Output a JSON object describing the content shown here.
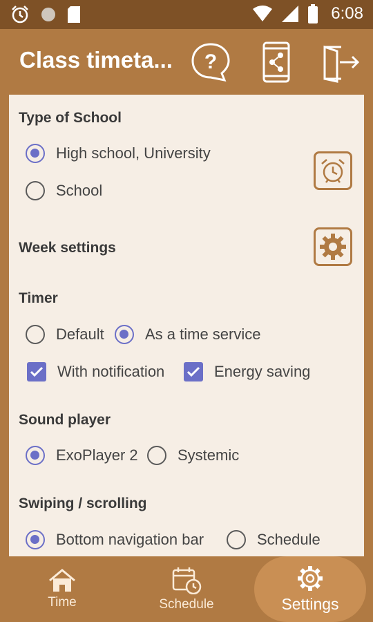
{
  "status": {
    "time": "6:08"
  },
  "appbar": {
    "title": "Class timeta..."
  },
  "sections": {
    "school": {
      "title": "Type of School",
      "options": [
        "High school, University",
        "School"
      ]
    },
    "week": {
      "title": "Week settings"
    },
    "timer": {
      "title": "Timer",
      "options": [
        "Default",
        "As a time service"
      ],
      "checks": [
        "With notification",
        "Energy saving"
      ]
    },
    "sound": {
      "title": "Sound player",
      "options": [
        "ExoPlayer 2",
        "Systemic"
      ]
    },
    "swipe": {
      "title": "Swiping / scrolling",
      "options": [
        "Bottom navigation bar",
        "Schedule"
      ]
    }
  },
  "bottom_nav": {
    "items": [
      "Time",
      "Schedule",
      "Settings"
    ]
  },
  "colors": {
    "accent": "#6B6FC7",
    "brand": "#B07A43",
    "statusbar": "#7E5126",
    "content_bg": "#F6EEE5"
  }
}
